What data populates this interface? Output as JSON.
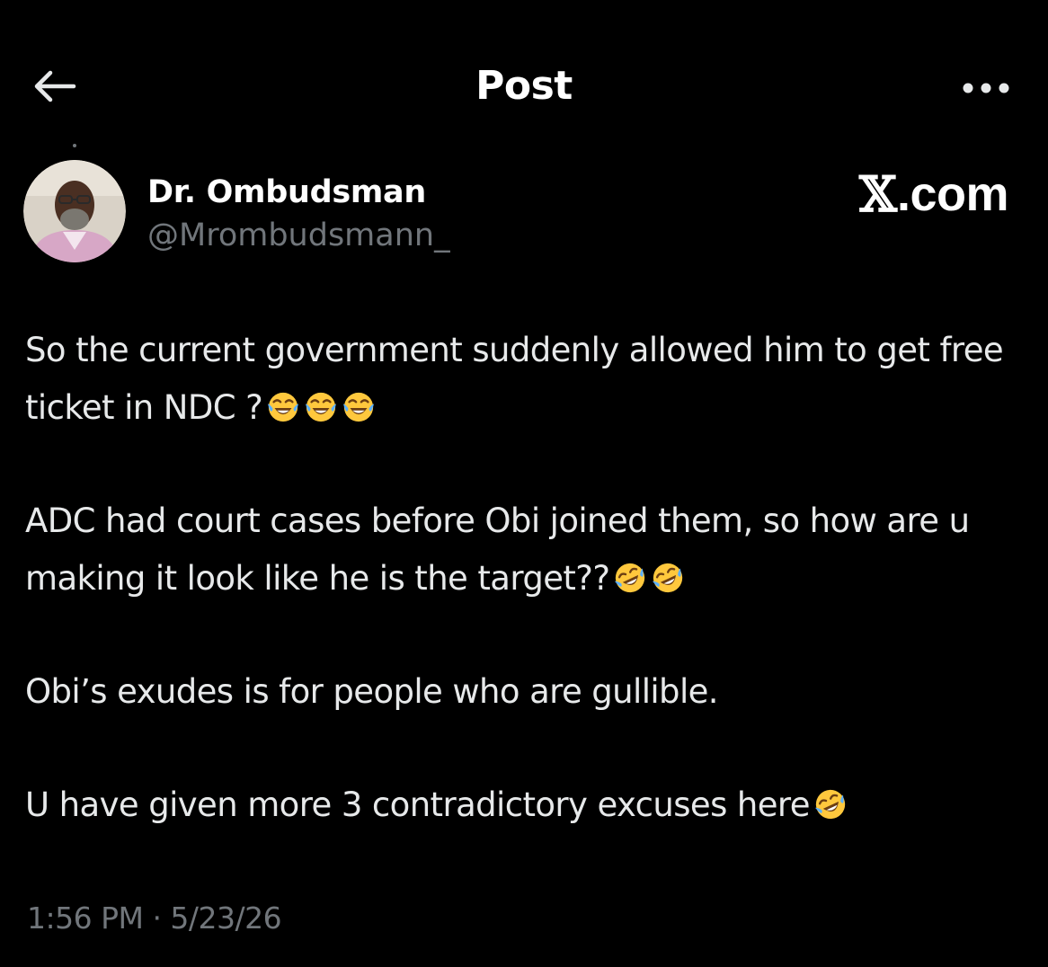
{
  "header": {
    "title": "Post",
    "back_icon": "arrow-left-icon",
    "more_icon": "more-horizontal-icon"
  },
  "author": {
    "name": "Dr. Ombudsman",
    "handle": "@Mrombudsmann_"
  },
  "watermark": {
    "logo": "𝕏",
    "domain": ".com"
  },
  "post": {
    "paragraphs": [
      {
        "text": "So the current government suddenly allowed him to get free ticket in NDC ?",
        "emojis": [
          "face-with-tears-of-joy",
          "face-with-tears-of-joy",
          "face-with-tears-of-joy"
        ]
      },
      {
        "text": "ADC had court cases before Obi joined them, so how are u making it look like he is the target??",
        "emojis": [
          "rolling-on-the-floor-laughing",
          "rolling-on-the-floor-laughing"
        ]
      },
      {
        "text": "Obi’s exudes is for people who are gullible.",
        "emojis": []
      },
      {
        "text": "U have given more 3 contradictory excuses here",
        "emojis": [
          "rolling-on-the-floor-laughing"
        ]
      }
    ],
    "timestamp": "1:56 PM · 5/23/26"
  },
  "colors": {
    "background": "#000000",
    "text_primary": "#e7e9ea",
    "text_secondary": "#71767b",
    "emoji_yellow": "#ffc83d",
    "emoji_tear": "#5ab0ff"
  }
}
